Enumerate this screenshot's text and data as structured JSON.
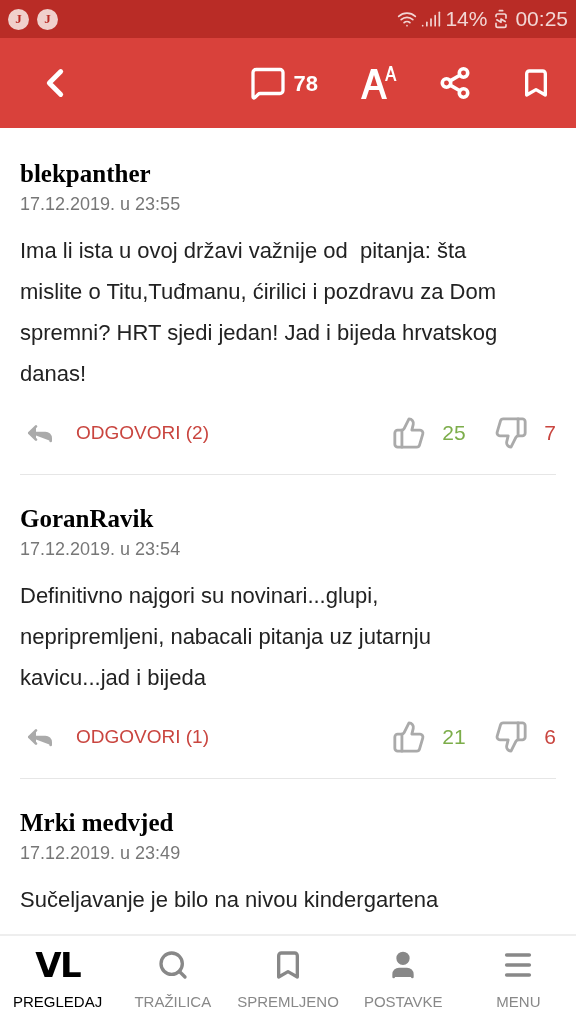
{
  "status_bar": {
    "notifications": [
      "J",
      "J"
    ],
    "battery": "14%",
    "time": "00:25"
  },
  "app_bar": {
    "comment_count": "78"
  },
  "comments": [
    {
      "author": "blekpanther",
      "date": "17.12.2019. u 23:55",
      "text": "Ima li ista u ovoj državi važnije od  pitanja: šta mislite o Titu,Tuđmanu, ćirilici i pozdravu za Dom spremni? HRT sjedi jedan! Jad i bijeda hrvatskog danas!",
      "reply": "ODGOVORI (2)",
      "likes": "25",
      "dislikes": "7"
    },
    {
      "author": "GoranRavik",
      "date": "17.12.2019. u 23:54",
      "text": "Definitivno najgori su novinari...glupi, nepripremljeni, nabacali pitanja uz jutarnju kavicu...jad i bijeda",
      "reply": "ODGOVORI (1)",
      "likes": "21",
      "dislikes": "6"
    },
    {
      "author": "Mrki medvjed",
      "date": "17.12.2019. u 23:49",
      "text": "Sučeljavanje je bilo na nivou kindergartena"
    }
  ],
  "bottom_nav": [
    {
      "kind": "logo",
      "logo": "VL",
      "label": "PREGLEDAJ",
      "selected": true
    },
    {
      "kind": "search",
      "label": "TRAŽILICA",
      "selected": false
    },
    {
      "kind": "bookmark",
      "label": "SPREMLJENO",
      "selected": false
    },
    {
      "kind": "person",
      "label": "POSTAVKE",
      "selected": false
    },
    {
      "kind": "menu",
      "label": "MENU",
      "selected": false
    }
  ]
}
